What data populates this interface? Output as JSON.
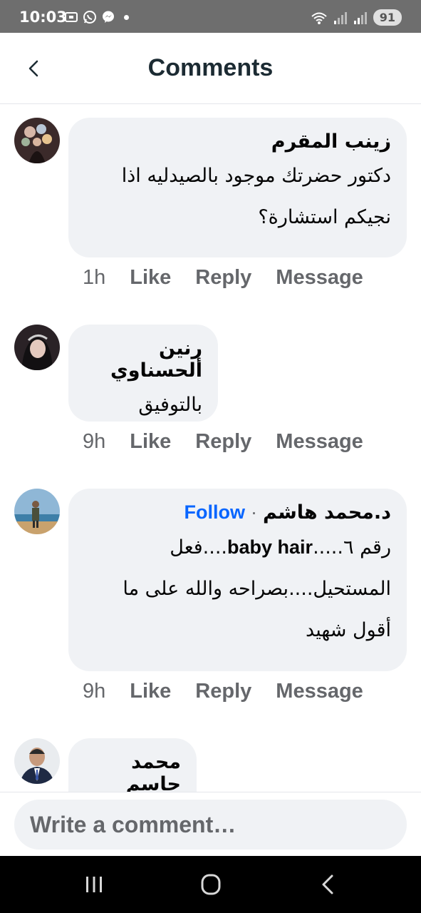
{
  "status_bar": {
    "time": "10:03",
    "battery": "91",
    "left_icons": [
      "screenshot-icon",
      "whatsapp-icon",
      "messenger-icon"
    ],
    "right_icons": [
      "wifi-icon",
      "signal-icon",
      "signal-icon"
    ]
  },
  "header": {
    "title": "Comments",
    "back_icon": "chevron-left-icon"
  },
  "comments": [
    {
      "author": "زينب المقرم",
      "lines": [
        "دكتور حضرتك  موجود بالصيدليه اذا",
        "نجيكم استشارة؟"
      ],
      "time": "1h",
      "like": "Like",
      "reply": "Reply",
      "message": "Message"
    },
    {
      "author": "رنين ألحسناوي",
      "lines": [
        "بالتوفيق"
      ],
      "time": "9h",
      "like": "Like",
      "reply": "Reply",
      "message": "Message"
    },
    {
      "author": "د.محمد هاشم",
      "follow_separator": "·",
      "follow": "Follow",
      "line1_pre": "رقم ٦.....",
      "line1_latin": "baby hair",
      "line1_post": "....فعل",
      "lines": [
        "المستحيل....بصراحه والله على ما",
        "أقول شهيد"
      ],
      "time": "9h",
      "like": "Like",
      "reply": "Reply",
      "message": "Message"
    },
    {
      "author": "محمد جاسم"
    }
  ],
  "composer": {
    "placeholder": "Write a comment…"
  },
  "colors": {
    "accent": "#0866ff",
    "bubble": "#f0f2f5",
    "secondary_text": "#65676b",
    "status_bar": "#6e6e6e"
  }
}
